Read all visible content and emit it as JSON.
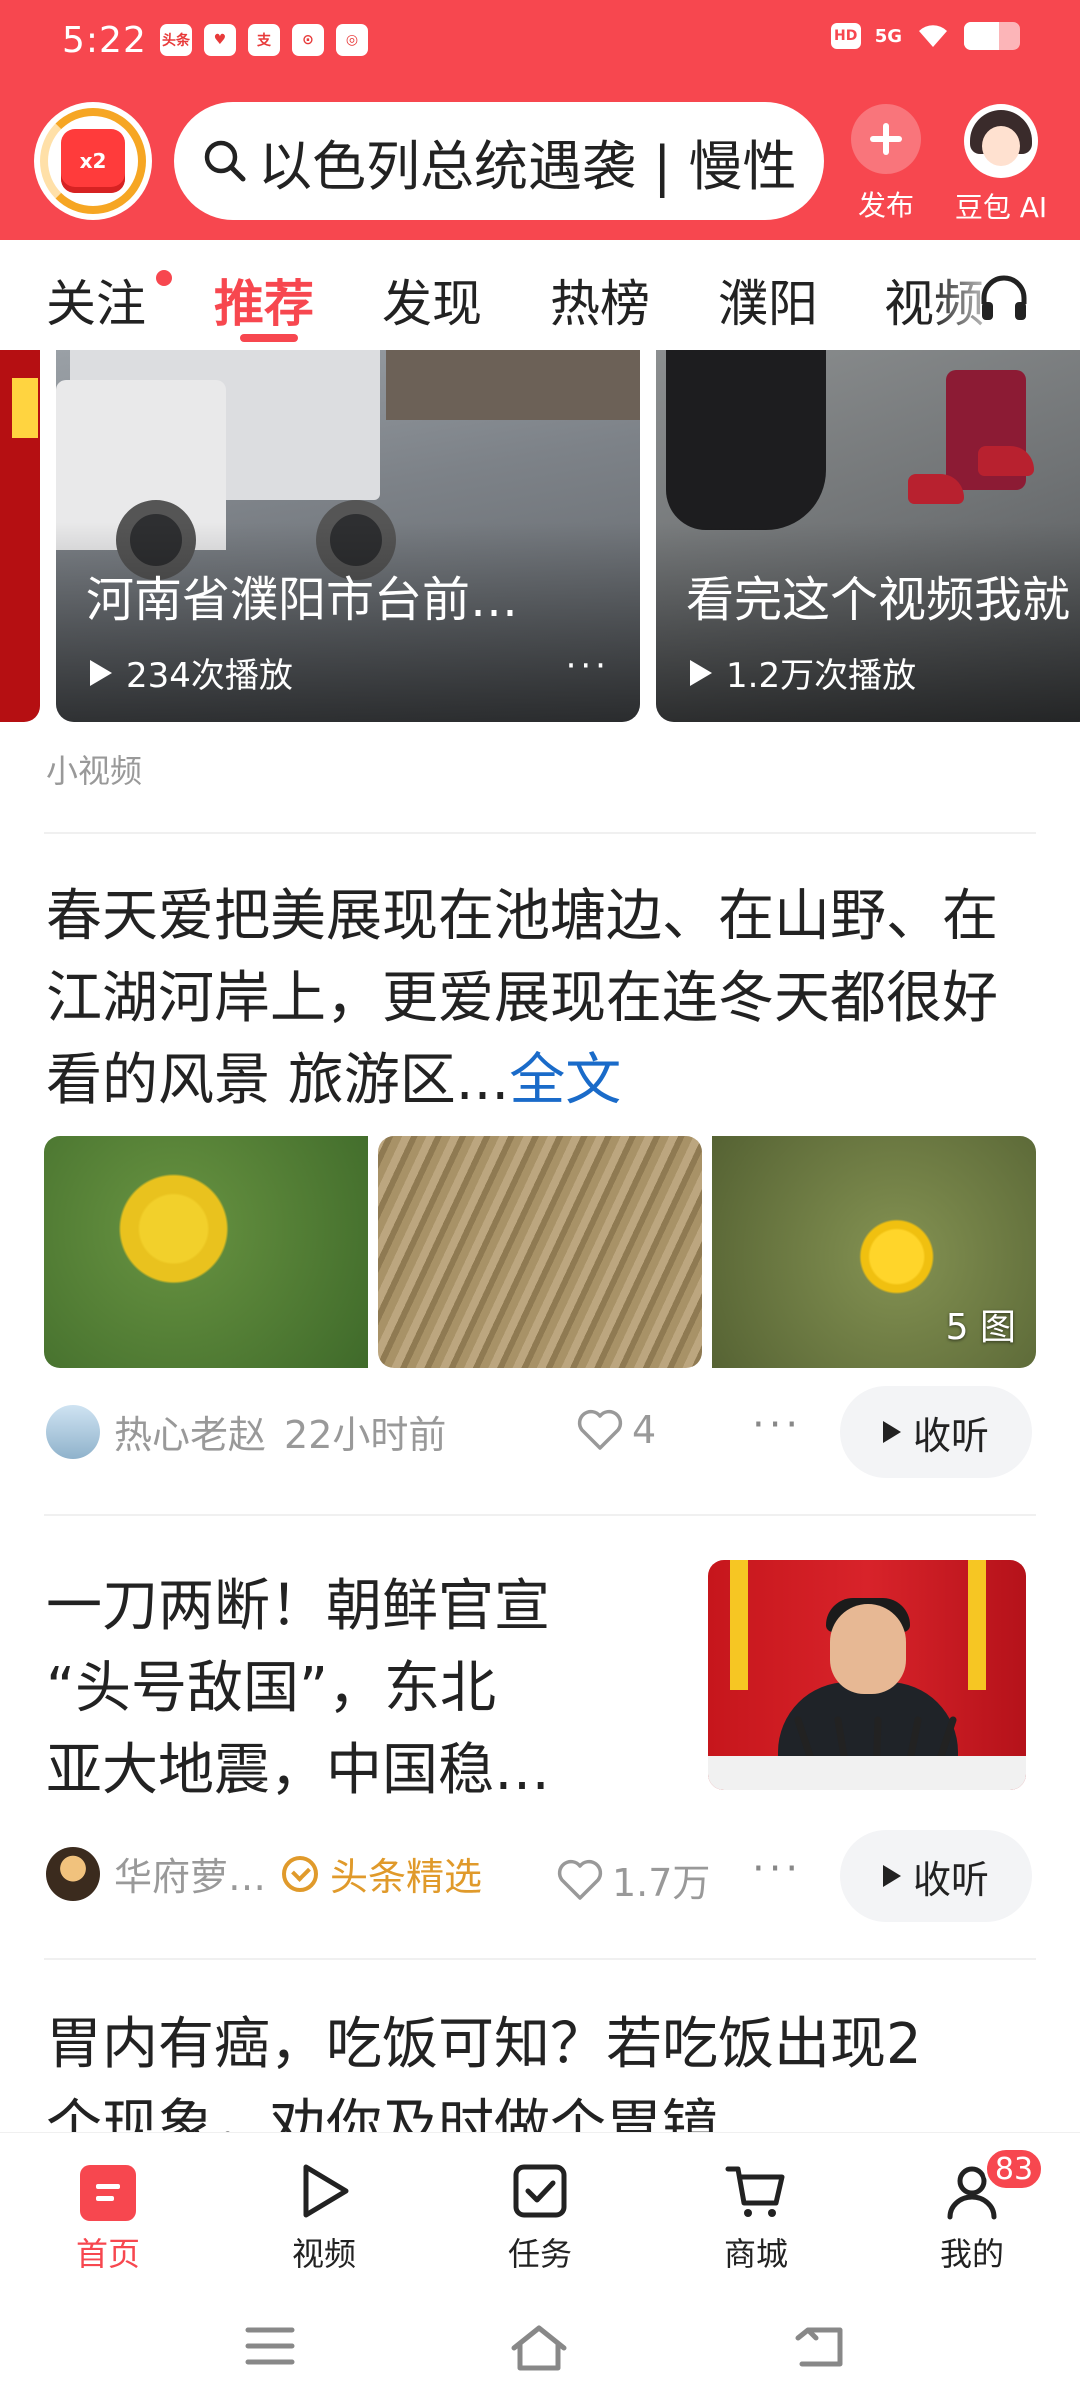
{
  "status_bar": {
    "time": "5:22",
    "apps": [
      "头条",
      "♥",
      "支",
      "⊙",
      "◎"
    ],
    "network": "5G",
    "hd": "HD",
    "battery_level": 0.62
  },
  "header": {
    "gift_badge": "x2",
    "search_text": "以色列总统遇袭 | 慢性",
    "publish_label": "发布",
    "doubao_label": "豆包 AI"
  },
  "tabs": {
    "items": [
      "关注",
      "推荐",
      "发现",
      "热榜",
      "濮阳",
      "视频"
    ],
    "active": "推荐"
  },
  "videos": [
    {
      "title": "河南省濮阳市台前…",
      "plays": "234次播放",
      "more": "···"
    },
    {
      "title": "看完这个视频我就",
      "plays": "1.2万次播放",
      "more": "···"
    }
  ],
  "section_label": "小视频",
  "article1": {
    "text": "春天爱把美展现在池塘边、在山野、在江湖河岸上，更爱展现在连冬天都很好看的风景 旅游区...",
    "more_label": "全文",
    "image_count": "5 图",
    "author": "热心老赵",
    "time": "22小时前",
    "likes": "4",
    "dots": "···",
    "listen_label": "收听"
  },
  "article2": {
    "lines": [
      "一刀两断！朝鲜官宣",
      "“头号敌国”，东北",
      "亚大地震，中国稳…"
    ],
    "author": "华府萝…",
    "selected_label": "头条精选",
    "likes": "1.7万",
    "dots": "···",
    "listen_label": "收听"
  },
  "article3": {
    "lines": [
      "胃内有癌，吃饭可知？若吃饭出现2",
      "个现象，劝你及时做个胃镜"
    ]
  },
  "bottom_nav": {
    "items": [
      "首页",
      "视频",
      "任务",
      "商城",
      "我的"
    ],
    "badge": "83"
  },
  "colors": {
    "brand": "#f7474f",
    "link": "#1a6bc9",
    "selected": "#e09a2b"
  }
}
